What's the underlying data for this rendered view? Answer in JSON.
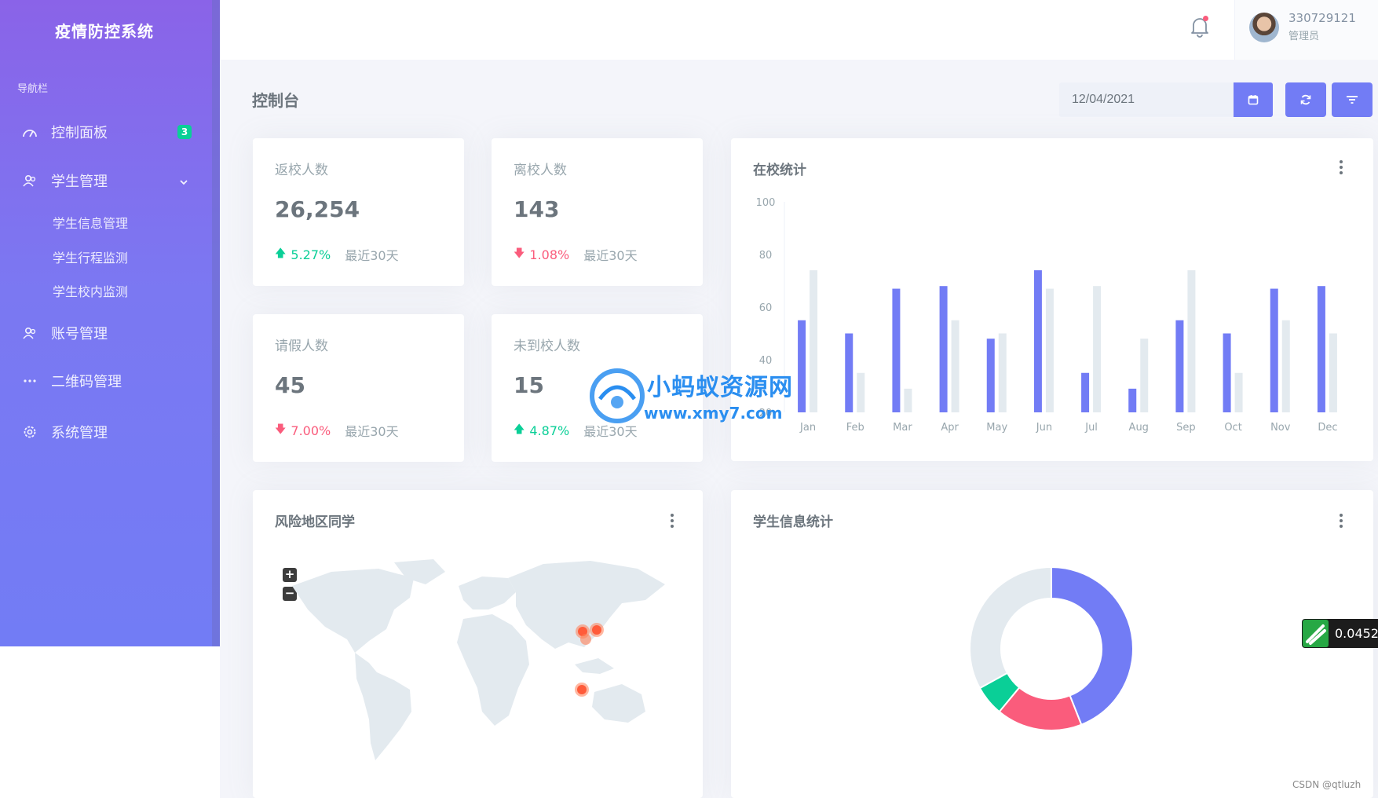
{
  "sidebar": {
    "brand": "疫情防控系统",
    "nav_title": "导航栏",
    "items": [
      {
        "label": "控制面板",
        "badge": "3"
      },
      {
        "label": "学生管理"
      },
      {
        "label": "账号管理"
      },
      {
        "label": "二维码管理"
      },
      {
        "label": "系统管理"
      }
    ],
    "sub_items": [
      "学生信息管理",
      "学生行程监测",
      "学生校内监测"
    ]
  },
  "topbar": {
    "user_name": "330729121",
    "user_role": "管理员"
  },
  "page": {
    "title": "控制台",
    "date_value": "12/04/2021"
  },
  "stats": [
    {
      "title": "返校人数",
      "value": "26,254",
      "change": "5.27%",
      "direction": "up",
      "period": "最近30天"
    },
    {
      "title": "离校人数",
      "value": "143",
      "change": "1.08%",
      "direction": "down",
      "period": "最近30天"
    },
    {
      "title": "请假人数",
      "value": "45",
      "change": "7.00%",
      "direction": "down",
      "period": "最近30天"
    },
    {
      "title": "未到校人数",
      "value": "15",
      "change": "4.87%",
      "direction": "up",
      "period": "最近30天"
    }
  ],
  "cards": {
    "bar_title": "在校统计",
    "map_title": "风险地区同学",
    "donut_title": "学生信息统计"
  },
  "map": {
    "zoom_in": "+",
    "zoom_out": "−"
  },
  "chart_data": [
    {
      "type": "bar",
      "title": "在校统计",
      "categories": [
        "Jan",
        "Feb",
        "Mar",
        "Apr",
        "May",
        "Jun",
        "Jul",
        "Aug",
        "Sep",
        "Oct",
        "Nov",
        "Dec"
      ],
      "series": [
        {
          "values": [
            55,
            50,
            67,
            68,
            48,
            74,
            35,
            29,
            55,
            50,
            67,
            68
          ],
          "color": "#727cf5"
        },
        {
          "values": [
            74,
            35,
            29,
            55,
            50,
            67,
            68,
            48,
            74,
            35,
            55,
            50
          ],
          "color": "#e3eaef"
        }
      ],
      "yticks": [
        100,
        80,
        60,
        40,
        20
      ],
      "ylim": [
        20,
        100
      ]
    },
    {
      "type": "pie",
      "title": "学生信息统计",
      "slices": [
        {
          "value": 44,
          "color": "#727cf5"
        },
        {
          "value": 17,
          "color": "#fa5c7c"
        },
        {
          "value": 6,
          "color": "#0acf97"
        },
        {
          "value": 33,
          "color": "#e3eaef"
        }
      ]
    }
  ],
  "watermark": {
    "name": "小蚂蚁资源网",
    "url": "www.xmy7.com"
  },
  "widget": {
    "value": "0.0452"
  },
  "footer": {
    "csdn": "CSDN @qtluzh"
  },
  "colors": {
    "primary": "#727cf5",
    "success": "#0acf97",
    "danger": "#fa5c7c",
    "light": "#e3eaef"
  }
}
